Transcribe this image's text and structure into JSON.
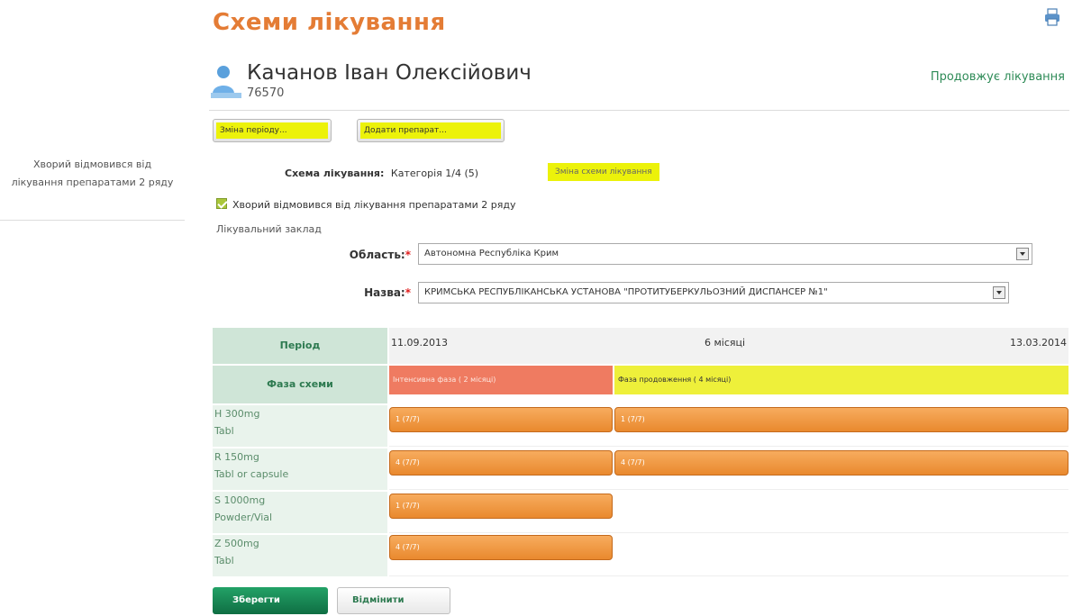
{
  "side_note": "Хворий відмовився від лікування препаратами 2 ряду",
  "page_title": "Схеми лікування",
  "patient": {
    "name": "Качанов Іван Олексійович",
    "id": "76570",
    "status": "Продовжує лікування"
  },
  "toolbar": {
    "change_period_label": "Зміна періоду...",
    "add_drug_label": "Додати препарат..."
  },
  "scheme": {
    "label": "Схема лікування:",
    "value": "Категорія 1/4 (5)",
    "change_link": "Зміна схеми лікування"
  },
  "refused_checkbox": {
    "checked": true,
    "label": "Хворий відмовився від лікування препаратами 2 ряду"
  },
  "facility_section_label": "Лікувальний заклад",
  "region": {
    "label": "Область:",
    "value": "Автономна Республіка Крим"
  },
  "facility_name": {
    "label": "Назва:",
    "value": "КРИМСЬКА РЕСПУБЛІКАНСЬКА УСТАНОВА \"ПРОТИТУБЕРКУЛЬОЗНИЙ ДИСПАНСЕР №1\""
  },
  "schedule": {
    "period_header": "Період",
    "phase_header": "Фаза схеми",
    "start_date": "11.09.2013",
    "duration": "6 місяці",
    "end_date": "13.03.2014",
    "phases": [
      {
        "label": "Інтенсивна фаза ( 2 місяці)",
        "color": "#ef7b61"
      },
      {
        "label": "Фаза продовження ( 4 місяці)",
        "color": "#eef03a"
      }
    ],
    "drugs": [
      {
        "name": "H 300mg",
        "form": "Tabl",
        "intensive": "1 (7/7)",
        "continuation": "1 (7/7)"
      },
      {
        "name": "R 150mg",
        "form": "Tabl or capsule",
        "intensive": "4 (7/7)",
        "continuation": "4 (7/7)"
      },
      {
        "name": "S 1000mg",
        "form": "Powder/Vial",
        "intensive": "1 (7/7)",
        "continuation": ""
      },
      {
        "name": "Z 500mg",
        "form": "Tabl",
        "intensive": "4 (7/7)",
        "continuation": ""
      }
    ]
  },
  "actions": {
    "save_label": "Зберегти",
    "cancel_label": "Відмінити"
  },
  "colors": {
    "title": "#e47c35",
    "status": "#2e8b57",
    "highlight": "#ecf20a",
    "save_button": "#178552",
    "dose_bar": "#ee9035"
  }
}
